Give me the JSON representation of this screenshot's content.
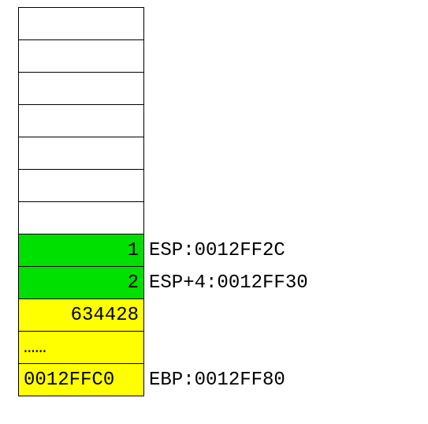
{
  "stack": [
    {
      "value": "",
      "bg": "",
      "align": "right",
      "label": ""
    },
    {
      "value": "",
      "bg": "",
      "align": "right",
      "label": ""
    },
    {
      "value": "",
      "bg": "",
      "align": "right",
      "label": ""
    },
    {
      "value": "",
      "bg": "",
      "align": "right",
      "label": ""
    },
    {
      "value": "",
      "bg": "",
      "align": "right",
      "label": ""
    },
    {
      "value": "",
      "bg": "",
      "align": "right",
      "label": ""
    },
    {
      "value": "",
      "bg": "",
      "align": "right",
      "label": ""
    },
    {
      "value": "1",
      "bg": "green",
      "align": "right",
      "label": "ESP:0012FF2C"
    },
    {
      "value": "2",
      "bg": "green",
      "align": "right",
      "label": "ESP+4:0012FF30"
    },
    {
      "value": "634428",
      "bg": "yellow",
      "align": "right",
      "label": ""
    },
    {
      "value": "……",
      "bg": "yellow",
      "align": "left",
      "label": ""
    },
    {
      "value": "0012FFC0",
      "bg": "yellow",
      "align": "left",
      "label": "EBP:0012FF80"
    }
  ]
}
